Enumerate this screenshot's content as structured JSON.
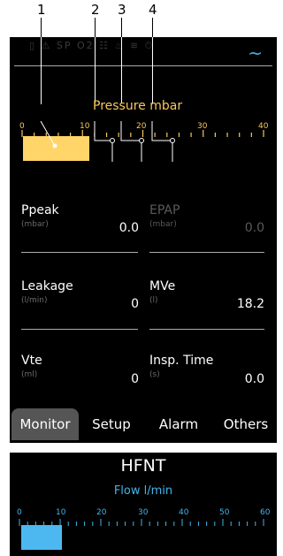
{
  "callouts": [
    "1",
    "2",
    "3",
    "4"
  ],
  "status": {
    "icons_text": "▯ ⚠ SP O2 ☷ ♨ ≋ ⏱",
    "wave_icon": "~"
  },
  "pressure": {
    "title": "Pressure mbar",
    "ticks": [
      "0",
      "10",
      "20",
      "30",
      "40"
    ],
    "value": 11,
    "scale_max": 40,
    "color": "#ffd468"
  },
  "params": [
    {
      "label": "Ppeak",
      "unit": "(mbar)",
      "value": "0.0",
      "dim": false
    },
    {
      "label": "EPAP",
      "unit": "(mbar)",
      "value": "0.0",
      "dim": true
    },
    {
      "label": "Leakage",
      "unit": "(l/min)",
      "value": "0",
      "dim": false
    },
    {
      "label": "MVe",
      "unit": "(l)",
      "value": "18.2",
      "dim": false
    },
    {
      "label": "Vte",
      "unit": "(ml)",
      "value": "0",
      "dim": false
    },
    {
      "label": "Insp. Time",
      "unit": "(s)",
      "value": "0.0",
      "dim": false
    }
  ],
  "tabs": [
    {
      "label": "Monitor",
      "active": true
    },
    {
      "label": "Setup",
      "active": false
    },
    {
      "label": "Alarm",
      "active": false
    },
    {
      "label": "Others",
      "active": false
    }
  ],
  "hfnt": {
    "title": "HFNT",
    "subtitle": "Flow l/min",
    "ticks": [
      "0",
      "10",
      "20",
      "30",
      "40",
      "50",
      "60"
    ],
    "value": 10,
    "scale_max": 60,
    "color": "#4db8f0"
  }
}
